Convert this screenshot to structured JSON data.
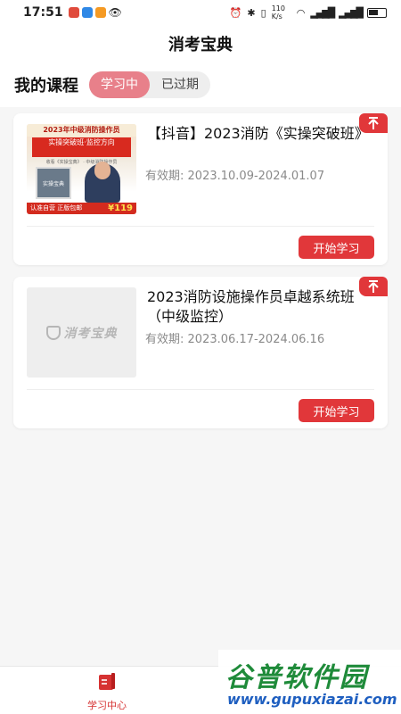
{
  "status_bar": {
    "time": "17:51",
    "network_speed": "110 K/s"
  },
  "header": {
    "title": "消考宝典"
  },
  "tabs_section": {
    "title": "我的课程",
    "tabs": [
      {
        "label": "学习中",
        "active": true
      },
      {
        "label": "已过期",
        "active": false
      }
    ]
  },
  "courses": [
    {
      "title": "【抖音】2023消防《实操突破班》",
      "valid_label": "有效期:",
      "valid_range": "2023.10.09-2024.01.07",
      "button": "开始学习",
      "thumbnail": {
        "top": "2023年中级消防操作员",
        "headline": "实操突破班·监控方向",
        "subline": "收看《实操宝典》 · 中级消防操作员",
        "book": "实操宝典",
        "bottom": "认准自营 正版包邮",
        "price": "¥119"
      }
    },
    {
      "title": "2023消防设施操作员卓越系统班（中级监控）",
      "valid_label": "有效期:",
      "valid_range": "2023.06.17-2024.06.16",
      "button": "开始学习",
      "thumbnail": {
        "logo": "消考宝典"
      }
    }
  ],
  "bottom_nav": {
    "items": [
      {
        "label": "学习中心",
        "icon": "book-icon",
        "active": true
      }
    ]
  },
  "watermark": {
    "main": "谷普软件园",
    "url": "www.gupuxiazai.com"
  },
  "colors": {
    "accent": "#e1373a",
    "tab_active": "#e8808a",
    "watermark_green": "#1f8b3a",
    "watermark_blue": "#1f5fc0"
  }
}
